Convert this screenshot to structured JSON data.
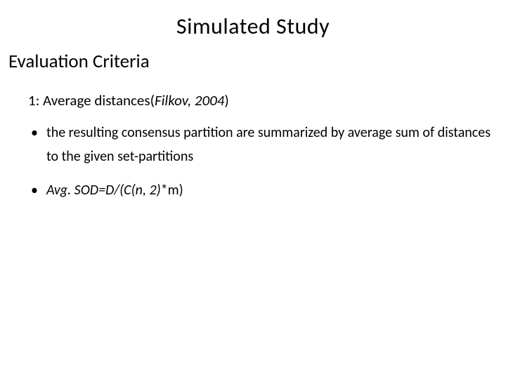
{
  "title": "Simulated Study",
  "subtitle": "Evaluation Criteria",
  "heading_prefix": "1: Average distances(",
  "heading_citation": "Filkov, 2004",
  "heading_suffix": ")",
  "bullet1": "the resulting consensus partition are summarized by average sum of distances to the given set-partitions",
  "bullet2_italic": "Avg. SOD=D/(C(n, 2)",
  "bullet2_rest": "*m)"
}
